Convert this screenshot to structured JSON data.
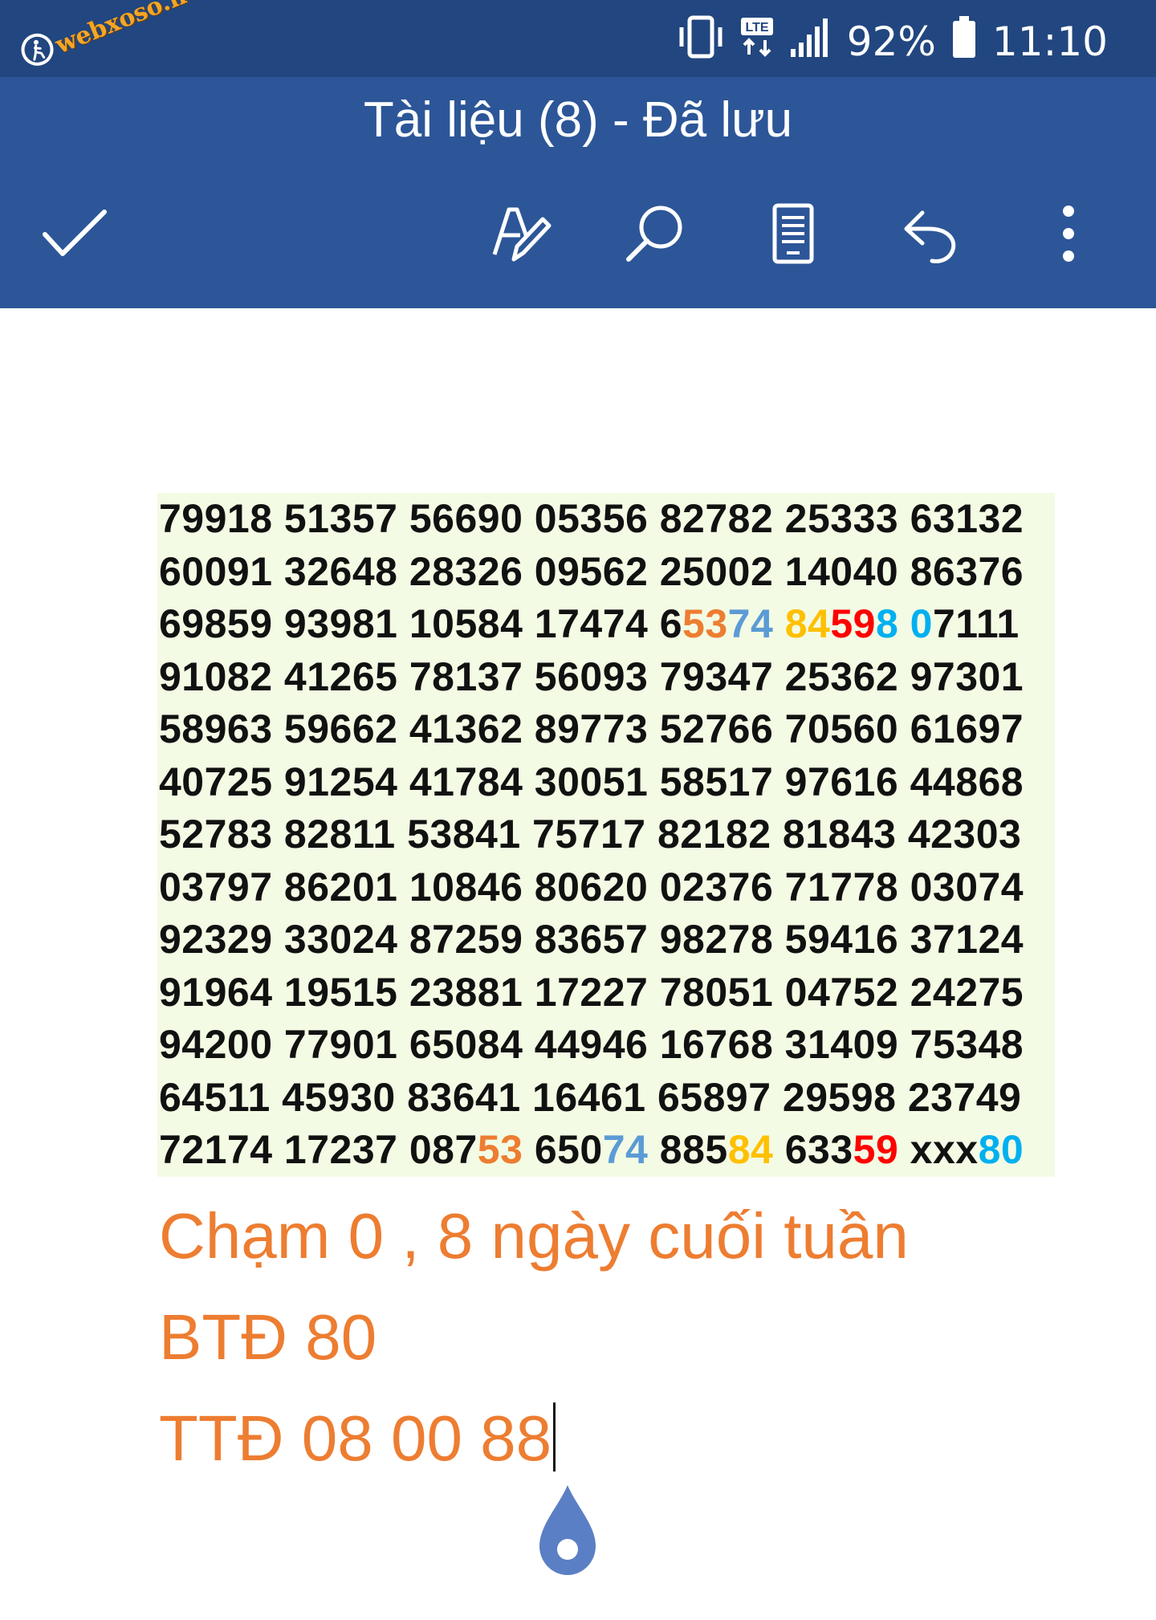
{
  "status_bar": {
    "watermark_text": "webxoso.net",
    "watermark_icon": "walking-person-icon",
    "battery": "92%",
    "time": "11:10",
    "network": "LTE",
    "icons": [
      "vibrate-icon",
      "lte-icon",
      "signal-icon",
      "battery-icon"
    ]
  },
  "app_bar": {
    "title": "Tài liệu (8) - Đã lưu",
    "buttons": [
      "check-icon",
      "draw-pen-icon",
      "search-icon",
      "reading-view-icon",
      "undo-icon",
      "more-vertical-icon"
    ]
  },
  "document": {
    "rows": [
      [
        {
          "t": "79918 51357 56690 05356 82782 25333 63132"
        }
      ],
      [
        {
          "t": "60091 32648 28326 09562 25002 14040 86376"
        }
      ],
      [
        {
          "t": "69859 93981 10584 17474 6"
        },
        {
          "t": "53",
          "c": "#ed7d31"
        },
        {
          "t": "74",
          "c": "#5b9bd5"
        },
        {
          "t": " "
        },
        {
          "t": "84",
          "c": "#ffc000"
        },
        {
          "t": "59",
          "c": "#ff0000"
        },
        {
          "t": "8",
          "c": "#00b0f0"
        },
        {
          "t": " "
        },
        {
          "t": "0",
          "c": "#00b0f0"
        },
        {
          "t": "7111"
        }
      ],
      [
        {
          "t": "91082 41265 78137 56093 79347 25362 97301"
        }
      ],
      [
        {
          "t": "58963 59662 41362 89773 52766 70560 61697"
        }
      ],
      [
        {
          "t": "40725 91254 41784 30051 58517 97616 44868"
        }
      ],
      [
        {
          "t": "52783 82811 53841 75717 82182 81843 42303"
        }
      ],
      [
        {
          "t": "03797 86201 10846 80620 02376 71778 03074"
        }
      ],
      [
        {
          "t": "92329 33024 87259 83657 98278 59416 37124"
        }
      ],
      [
        {
          "t": "91964 19515 23881 17227 78051 04752 24275"
        }
      ],
      [
        {
          "t": "94200 77901 65084 44946 16768 31409 75348"
        }
      ],
      [
        {
          "t": "64511 45930 83641 16461 65897 29598 23749"
        }
      ],
      [
        {
          "t": "72174 17237 087"
        },
        {
          "t": "53",
          "c": "#ed7d31"
        },
        {
          "t": " 650"
        },
        {
          "t": "74",
          "c": "#5b9bd5"
        },
        {
          "t": " 885"
        },
        {
          "t": "84",
          "c": "#ffc000"
        },
        {
          "t": " 633"
        },
        {
          "t": "59",
          "c": "#ff0000"
        },
        {
          "t": " xxx"
        },
        {
          "t": "80",
          "c": "#00b0f0"
        }
      ]
    ],
    "notes": {
      "line1": "Chạm 0 , 8 ngày cuối tuần",
      "line2": "BTĐ 80",
      "line3": "TTĐ 08 00 88"
    }
  },
  "colors": {
    "status_bar": "#22467f",
    "app_bar": "#2c5698",
    "row_highlight": "#f3fbe4",
    "note_text": "#ed7d31",
    "drop_handle": "#5b7fc4"
  }
}
